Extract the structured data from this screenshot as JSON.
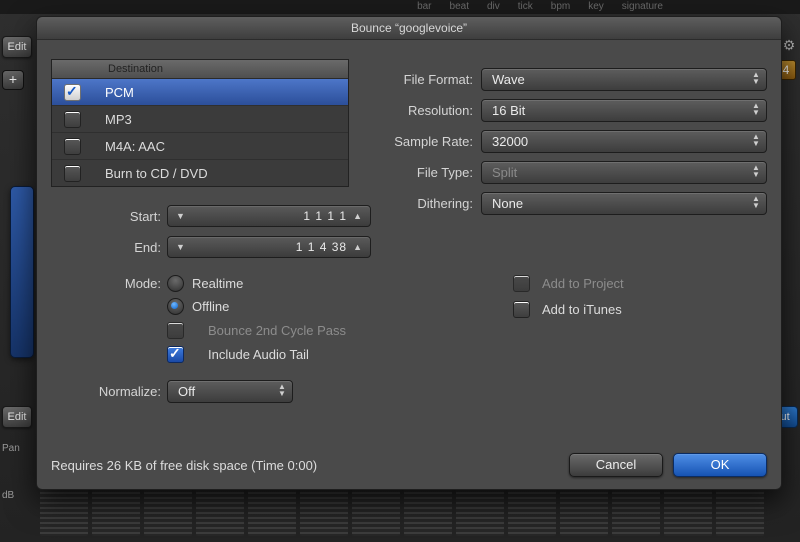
{
  "background": {
    "transport_labels": [
      "bar",
      "beat",
      "div",
      "tick",
      "bpm",
      "key",
      "signature"
    ],
    "edit_label": "Edit",
    "pan_label": "Pan",
    "db_label": "dB",
    "out_label": "out",
    "four": "4"
  },
  "dialog": {
    "title": "Bounce “googlevoice”",
    "destination_header": "Destination",
    "destinations": [
      {
        "label": "PCM",
        "checked": true,
        "selected": true
      },
      {
        "label": "MP3",
        "checked": false,
        "selected": false
      },
      {
        "label": "M4A: AAC",
        "checked": false,
        "selected": false
      },
      {
        "label": "Burn to CD / DVD",
        "checked": false,
        "selected": false
      }
    ],
    "start_label": "Start:",
    "start_value": "1 1 1    1",
    "end_label": "End:",
    "end_value": "1 1 4   38",
    "mode_label": "Mode:",
    "mode_options": {
      "realtime": "Realtime",
      "offline": "Offline"
    },
    "mode_selected": "offline",
    "bounce2nd_label": "Bounce 2nd Cycle Pass",
    "include_tail_label": "Include Audio Tail",
    "include_tail_checked": true,
    "normalize_label": "Normalize:",
    "normalize_value": "Off",
    "format": {
      "file_format_label": "File Format:",
      "file_format_value": "Wave",
      "resolution_label": "Resolution:",
      "resolution_value": "16 Bit",
      "sample_rate_label": "Sample Rate:",
      "sample_rate_value": "32000",
      "file_type_label": "File Type:",
      "file_type_value": "Split",
      "dithering_label": "Dithering:",
      "dithering_value": "None"
    },
    "add_to_project_label": "Add to Project",
    "add_to_itunes_label": "Add to iTunes",
    "footer_info": "Requires 26 KB of free disk space  (Time 0:00)",
    "cancel_label": "Cancel",
    "ok_label": "OK"
  }
}
